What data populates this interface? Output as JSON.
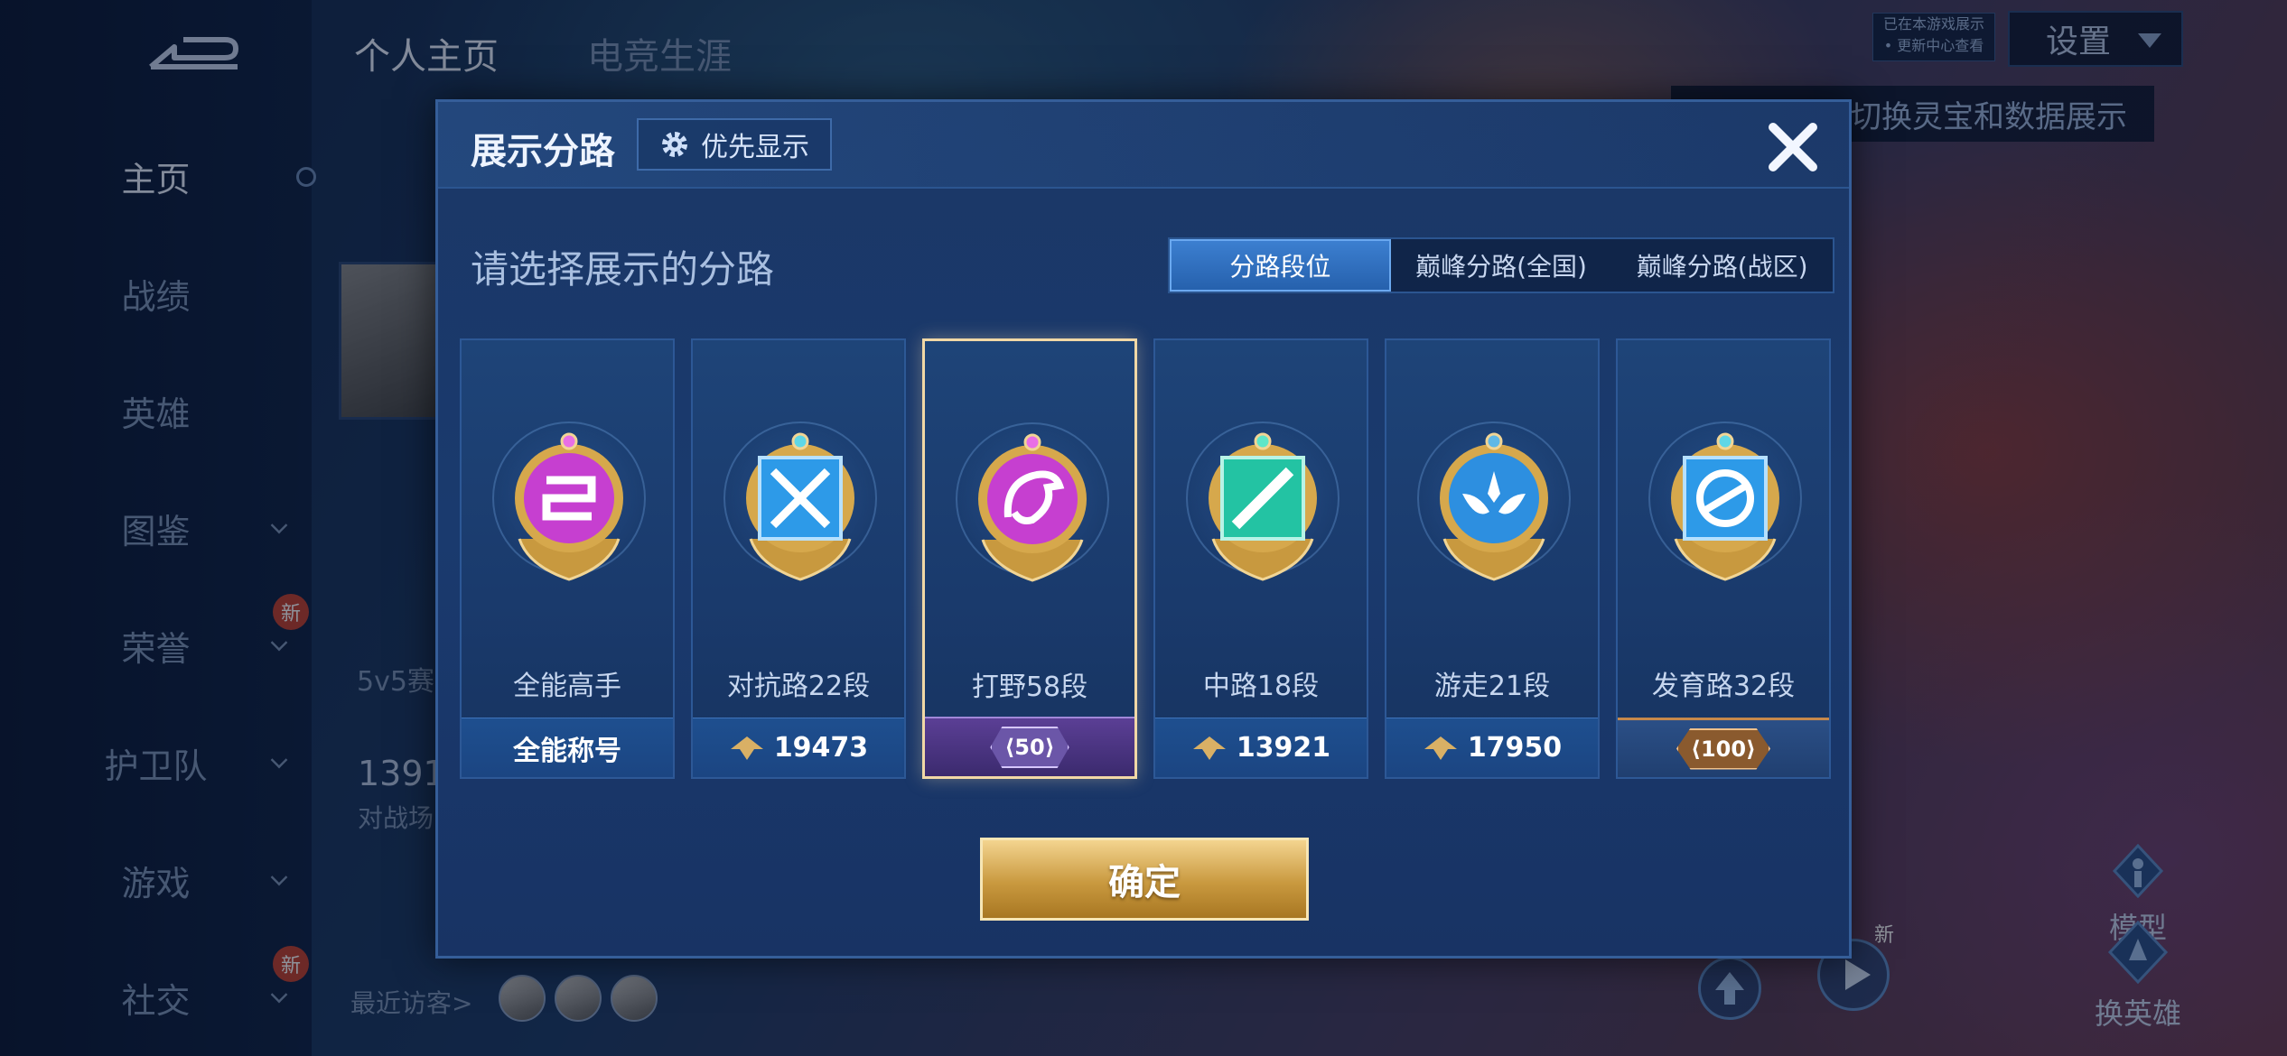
{
  "sidebar": {
    "items": [
      {
        "label": "主页",
        "active": true
      },
      {
        "label": "战绩"
      },
      {
        "label": "英雄"
      },
      {
        "label": "图鉴",
        "has_chevron": true
      },
      {
        "label": "荣誉",
        "has_chevron": true,
        "badge": "新"
      },
      {
        "label": "护卫队",
        "has_chevron": true
      },
      {
        "label": "游戏",
        "has_chevron": true
      },
      {
        "label": "社交",
        "has_chevron": true,
        "badge": "新"
      }
    ]
  },
  "background": {
    "tabs": [
      "个人主页",
      "电竞生涯"
    ],
    "settings_label": "设置",
    "version_tag": [
      "已在本游戏展示",
      "• 更新中心查看"
    ],
    "hint_text": "以切换灵宝和数据展示",
    "match_mode_text": "5v5赛",
    "count_text": "1391",
    "battle_text": "对战场",
    "recent_visitors_label": "最近访客>",
    "model_label": "模型",
    "switch_hero_label": "换英雄",
    "new_badge": "新"
  },
  "modal": {
    "title": "展示分路",
    "priority_button": "优先显示",
    "subtitle": "请选择展示的分路",
    "tabs": [
      "分路段位",
      "巅峰分路(全国)",
      "巅峰分路(战区)"
    ],
    "active_tab": 0,
    "confirm_label": "确定",
    "cards": [
      {
        "name": "全能高手",
        "footer": "全能称号",
        "emblem": "allround-emblem",
        "color": "#c63fd0"
      },
      {
        "name": "对抗路22段",
        "footer": "19473",
        "emblem": "clash-lane-emblem",
        "color": "#2d9ae8"
      },
      {
        "name": "打野58段",
        "footer": "50",
        "emblem": "jungle-dragon-emblem",
        "color": "#c63fd0",
        "selected": true
      },
      {
        "name": "中路18段",
        "footer": "13921",
        "emblem": "mid-lane-emblem",
        "color": "#23c3a3"
      },
      {
        "name": "游走21段",
        "footer": "17950",
        "emblem": "roam-wings-emblem",
        "color": "#2d8fe0"
      },
      {
        "name": "发育路32段",
        "footer": "100",
        "emblem": "farm-lane-emblem",
        "color": "#2d9ae8"
      }
    ]
  },
  "colors": {
    "accent_gold": "#d9b065",
    "tab_active": "#2f6fc0",
    "modal_bg": "#1a3a6e"
  }
}
